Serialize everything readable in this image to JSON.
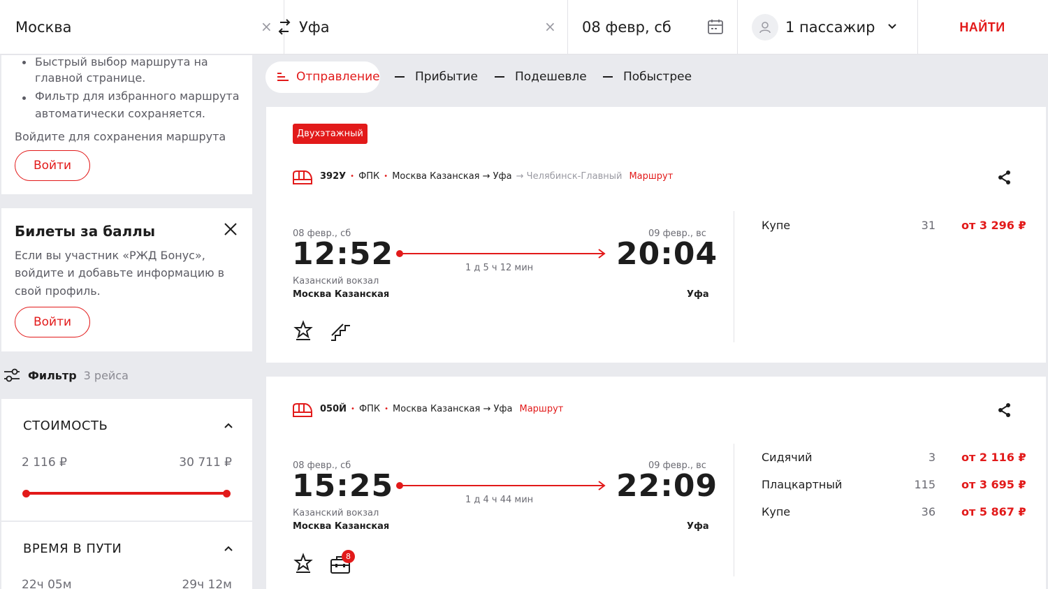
{
  "search": {
    "from": "Москва",
    "to": "Уфа",
    "date": "08 февр, сб",
    "passengers": "1 пассажир",
    "find_label": "НАЙТИ",
    "clear_glyph": "×"
  },
  "sidebar": {
    "favorites": {
      "bullets": [
        "Быстрый выбор маршрута на",
        "главной странице.",
        "Фильтр для избранного маршрута",
        "автоматически сохраняется."
      ],
      "note": "Войдите для сохранения маршрута",
      "login_label": "Войти"
    },
    "bonus": {
      "title": "Билеты за баллы",
      "text_lines": [
        "Если вы участник «РЖД Бонус»,",
        "войдите и добавьте информацию в",
        "свой профиль."
      ],
      "login_label": "Войти"
    },
    "filter": {
      "label": "Фильтр",
      "count": "3 рейса"
    },
    "cost": {
      "title": "СТОИМОСТЬ",
      "min": "2 116 ₽",
      "max": "30 711 ₽",
      "range": [
        0,
        1
      ]
    },
    "travel_time": {
      "title": "ВРЕМЯ В ПУТИ",
      "min": "22ч 05м",
      "max": "29ч 12м"
    }
  },
  "sort": {
    "items": [
      "Отправление",
      "Прибытие",
      "Подешевле",
      "Побыстрее"
    ],
    "active_index": 0
  },
  "trains": [
    {
      "badge": "Двухэтажный",
      "number": "392У",
      "carrier": "ФПК",
      "route": "Москва Казанская → Уфа",
      "route_extra": "→ Челябинск-Главный",
      "route_link": "Маршрут",
      "dep_date": "08 февр., сб",
      "dep_time": "12:52",
      "dep_station_note": "Казанский вокзал",
      "dep_station": "Москва Казанская",
      "arr_date": "09 февр., вс",
      "arr_time": "20:04",
      "arr_station": "Уфа",
      "duration": "1 д 5 ч 12 мин",
      "amenities": [
        "star-service-icon",
        "stairs-icon"
      ],
      "classes": [
        {
          "name": "Купе",
          "seats": "31",
          "price": "от 3 296 ₽"
        }
      ]
    },
    {
      "number": "050Й",
      "carrier": "ФПК",
      "route": "Москва Казанская → Уфа",
      "route_link": "Маршрут",
      "dep_date": "08 февр., сб",
      "dep_time": "15:25",
      "dep_station_note": "Казанский вокзал",
      "dep_station": "Москва Казанская",
      "arr_date": "09 февр., вс",
      "arr_time": "22:09",
      "arr_station": "Уфа",
      "duration": "1 д 4 ч 44 мин",
      "amenities": [
        "star-service-icon",
        "luggage-icon"
      ],
      "amenity_badge": "8",
      "classes": [
        {
          "name": "Сидячий",
          "seats": "3",
          "price": "от 2 116 ₽"
        },
        {
          "name": "Плацкартный",
          "seats": "115",
          "price": "от 3 695 ₽"
        },
        {
          "name": "Купе",
          "seats": "36",
          "price": "от 5 867 ₽"
        }
      ]
    }
  ],
  "colors": {
    "accent": "#e21a1a",
    "background": "#e9eaee",
    "card": "#ffffff",
    "muted": "#6b6b73"
  }
}
